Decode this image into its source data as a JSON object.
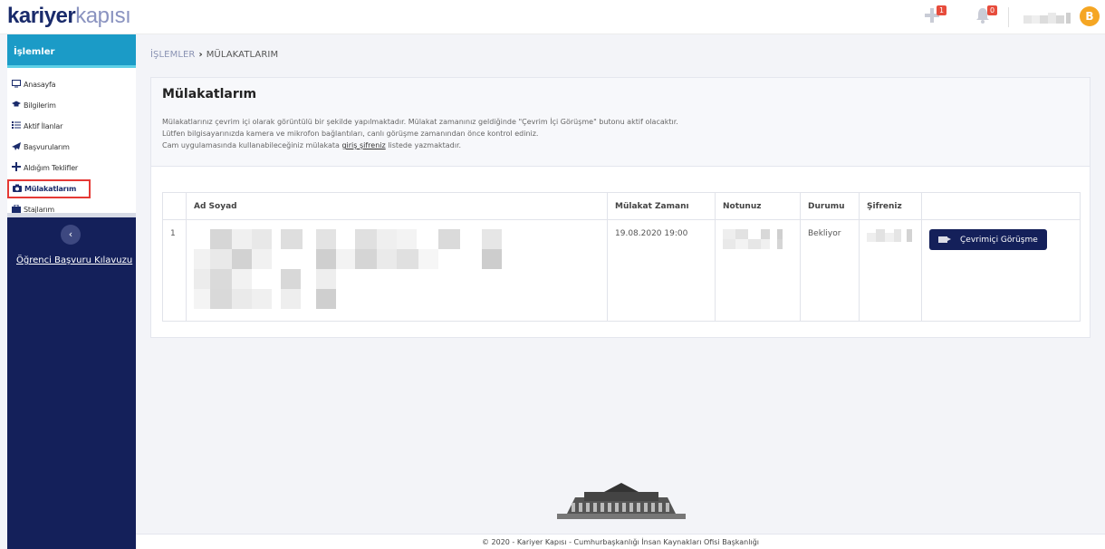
{
  "logo": {
    "part1": "kariyer",
    "part2": "kapısı"
  },
  "header": {
    "cart_badge": "1",
    "notif_badge": "0",
    "avatar_initial": "B"
  },
  "sidebar": {
    "title": "İşlemler",
    "items": [
      {
        "label": "Anasayfa",
        "icon": "monitor-icon"
      },
      {
        "label": "Bilgilerim",
        "icon": "graduation-cap-icon"
      },
      {
        "label": "Aktif İlanlar",
        "icon": "list-icon"
      },
      {
        "label": "Başvurularım",
        "icon": "paper-plane-icon"
      },
      {
        "label": "Aldığım Teklifler",
        "icon": "plus-icon"
      },
      {
        "label": "Mülakatlarım",
        "icon": "camera-icon"
      },
      {
        "label": "Stajlarım",
        "icon": "briefcase-icon"
      }
    ],
    "guide_link": "Öğrenci Başvuru Kılavuzu"
  },
  "breadcrumb": {
    "root": "İŞLEMLER",
    "current": "MÜLAKATLARIM"
  },
  "panel": {
    "title": "Mülakatlarım",
    "desc_line1": "Mülakatlarınız çevrim içi olarak görüntülü bir şekilde yapılmaktadır. Mülakat zamanınız geldiğinde \"Çevrim İçi Görüşme\" butonu aktif olacaktır.",
    "desc_line2": "Lütfen bilgisayarınızda kamera ve mikrofon bağlantıları, canlı görüşme zamanından önce kontrol ediniz.",
    "desc_line3_pre": "Cam uygulamasında kullanabileceğiniz mülakata ",
    "desc_line3_link": "giriş şifreniz",
    "desc_line3_post": " listede yazmaktadır."
  },
  "table": {
    "headers": [
      "",
      "Ad Soyad",
      "Mülakat Zamanı",
      "Notunuz",
      "Durumu",
      "Şifreniz",
      ""
    ],
    "rows": [
      {
        "index": "1",
        "time": "19.08.2020 19:00",
        "status": "Bekliyor",
        "action_label": "Çevrimiçi Görüşme"
      }
    ]
  },
  "footer": {
    "text": "© 2020 - Kariyer Kapısı - Cumhurbaşkanlığı İnsan Kaynakları Ofisi Başkanlığı"
  }
}
